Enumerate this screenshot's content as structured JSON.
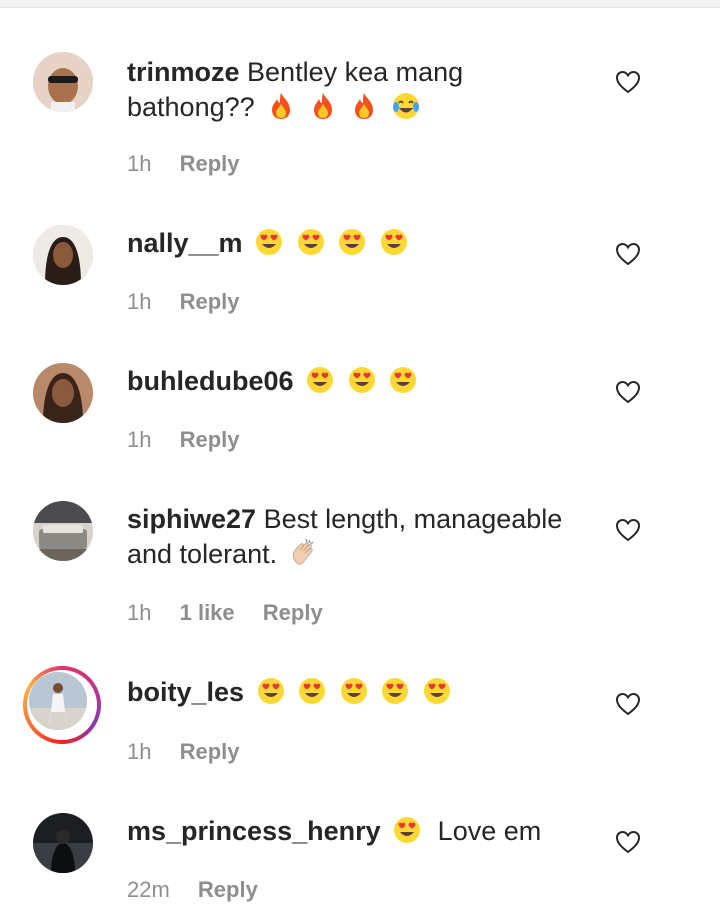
{
  "comments": [
    {
      "username": "trinmoze",
      "text_line1": "Bentley kea mang",
      "text_line2": "bathong??",
      "emojis": [
        "fire-icon",
        "fire-icon",
        "fire-icon",
        "tears-of-joy-icon"
      ],
      "time": "1h",
      "reply_label": "Reply"
    },
    {
      "username": "nally__m",
      "emojis": [
        "heart-eyes-icon",
        "heart-eyes-icon",
        "heart-eyes-icon",
        "heart-eyes-icon"
      ],
      "time": "1h",
      "reply_label": "Reply"
    },
    {
      "username": "buhledube06",
      "emojis": [
        "heart-eyes-icon",
        "heart-eyes-icon",
        "heart-eyes-icon"
      ],
      "time": "1h",
      "reply_label": "Reply"
    },
    {
      "username": "siphiwe27",
      "text_line1": "Best length, manageable",
      "text_line2": "and tolerant.",
      "emojis": [
        "clapping-hands-icon"
      ],
      "time": "1h",
      "likes": "1 like",
      "reply_label": "Reply"
    },
    {
      "username": "boity_les",
      "emojis": [
        "heart-eyes-icon",
        "heart-eyes-icon",
        "heart-eyes-icon",
        "heart-eyes-icon",
        "heart-eyes-icon"
      ],
      "time": "1h",
      "reply_label": "Reply",
      "has_story_ring": true
    },
    {
      "username": "ms_princess_henry",
      "emojis": [
        "heart-eyes-icon"
      ],
      "text_after": "Love em",
      "time": "22m",
      "reply_label": "Reply"
    }
  ],
  "colors": {
    "text": "#262626",
    "meta": "#8e8e8e",
    "story_ring": "#e1306c"
  }
}
